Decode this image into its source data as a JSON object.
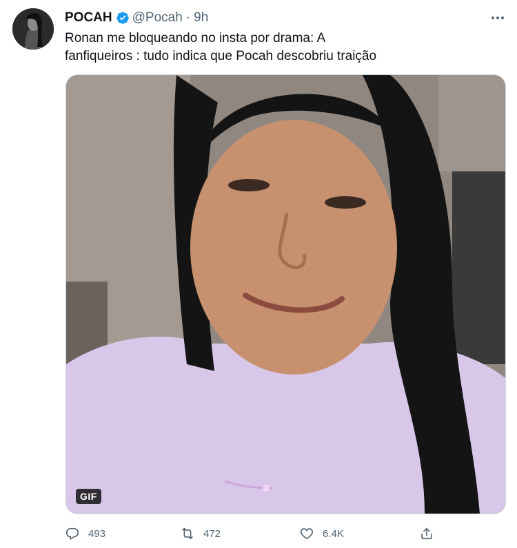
{
  "tweet": {
    "author_name": "POCAH",
    "handle": "@Pocah",
    "separator": "·",
    "time": "9h",
    "text_line1": "Ronan me bloqueando no insta por drama: A",
    "text_line2": "fanfiqueiros : tudo indica que Pocah descobriu traição",
    "media_badge": "GIF"
  },
  "actions": {
    "reply_count": "493",
    "retweet_count": "472",
    "like_count": "6.4K"
  },
  "icons": {
    "verified": "verified-badge-icon",
    "more": "more-options-icon",
    "reply": "reply-icon",
    "retweet": "retweet-icon",
    "like": "heart-icon",
    "share": "share-icon"
  },
  "colors": {
    "verified_blue": "#1d9bf0",
    "secondary_text": "#536471",
    "primary_text": "#0f1419"
  }
}
